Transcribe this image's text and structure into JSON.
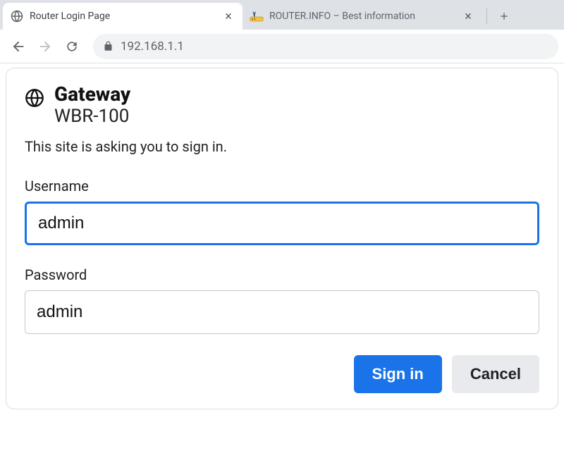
{
  "tabs": [
    {
      "title": "Router Login Page"
    },
    {
      "title": "ROUTER.INFO – Best information"
    }
  ],
  "address": {
    "url": "192.168.1.1"
  },
  "dialog": {
    "brand": "Gateway",
    "model": "WBR-100",
    "prompt": "This site is asking you to sign in.",
    "username_label": "Username",
    "username_value": "admin",
    "password_label": "Password",
    "password_value": "admin",
    "signin_label": "Sign in",
    "cancel_label": "Cancel"
  }
}
